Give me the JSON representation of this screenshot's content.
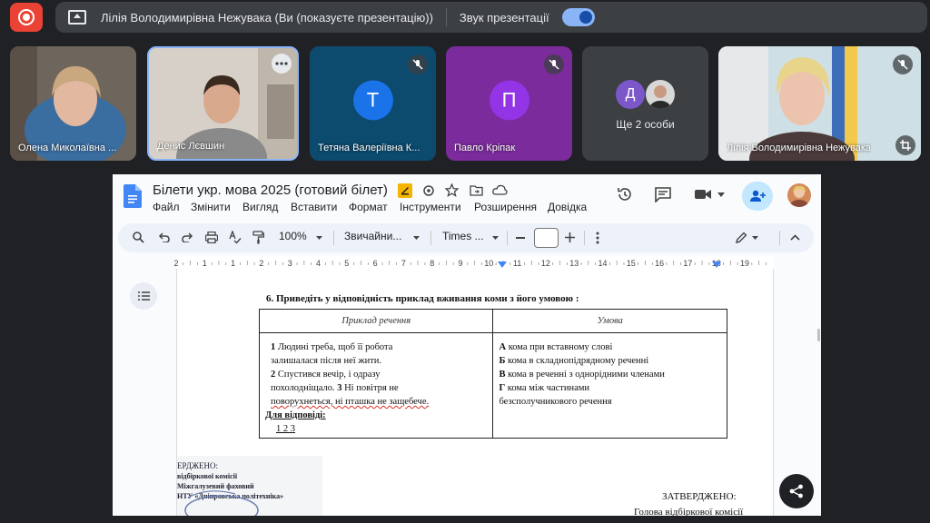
{
  "top_bar": {
    "presenter_text": "Лілія Володимирівна Нежувака (Ви (показуєте презентацію))",
    "sound_label": "Звук презентації"
  },
  "participants": [
    {
      "name": "Олена Миколаївна ..."
    },
    {
      "name": "Денис Лєвшин"
    },
    {
      "name": "Тетяна Валеріївна К...",
      "initial": "Т",
      "color": "#1a73e8"
    },
    {
      "name": "Павло Кріпак",
      "initial": "П",
      "color": "#9334e6"
    },
    {
      "name": "Ще 2 особи",
      "initial": "Д",
      "color": "#7b57c9"
    },
    {
      "name": "Лілія Володимирівна Нежувака"
    }
  ],
  "document": {
    "title": "Білети укр. мова 2025 (готовий білет)",
    "menu": [
      "Файл",
      "Змінити",
      "Вигляд",
      "Вставити",
      "Формат",
      "Інструменти",
      "Розширення",
      "Довідка"
    ],
    "toolbar": {
      "zoom": "100%",
      "style": "Звичайни...",
      "font": "Times ...",
      "size": ""
    },
    "ruler_numbers": [
      "2",
      "1",
      "1",
      "2",
      "3",
      "4",
      "5",
      "6",
      "7",
      "8",
      "9",
      "10",
      "11",
      "12",
      "13",
      "14",
      "15",
      "16",
      "17",
      "18",
      "19"
    ],
    "question": "6. Приведіть у відповідність приклад вживання коми з його умовою :",
    "table": {
      "headers": [
        "Приклад речення",
        "Умова"
      ],
      "left_lines": [
        {
          "num": "1",
          "text": " Людині треба, щоб її робота"
        },
        {
          "num": "",
          "text": "залишалася після неї жити."
        },
        {
          "num": "2",
          "text": " Спустився вечір, і одразу"
        },
        {
          "num": "",
          "text": "похолодніщало. "
        },
        {
          "num": "3",
          "text": " Ні повітря не"
        },
        {
          "num": "",
          "text": "поворухнеться, ні пташка не  защебече."
        }
      ],
      "answer_label": "Для відповіді:",
      "answer_values": "1 2 3",
      "right_lines": [
        {
          "letter": "А",
          "text": " кома при вставному слові"
        },
        {
          "letter": "Б",
          "text": " кома в складнопідрядному реченні"
        },
        {
          "letter": "В",
          "text": " кома в реченні з однорідними членами"
        },
        {
          "letter": "Г",
          "text": " кома між частинами"
        },
        {
          "letter": "",
          "text": "безсполучникового  речення"
        }
      ]
    },
    "stamp_lines": [
      "ЕРДЖЕНО:",
      "відбіркової комісії",
      "Міжгалузевий фаховий",
      "НТУ «Дніпровська політехніка»"
    ],
    "approved": "ЗАТВЕРДЖЕНО:",
    "approved_sub": "Голова відбіркової комісії"
  }
}
